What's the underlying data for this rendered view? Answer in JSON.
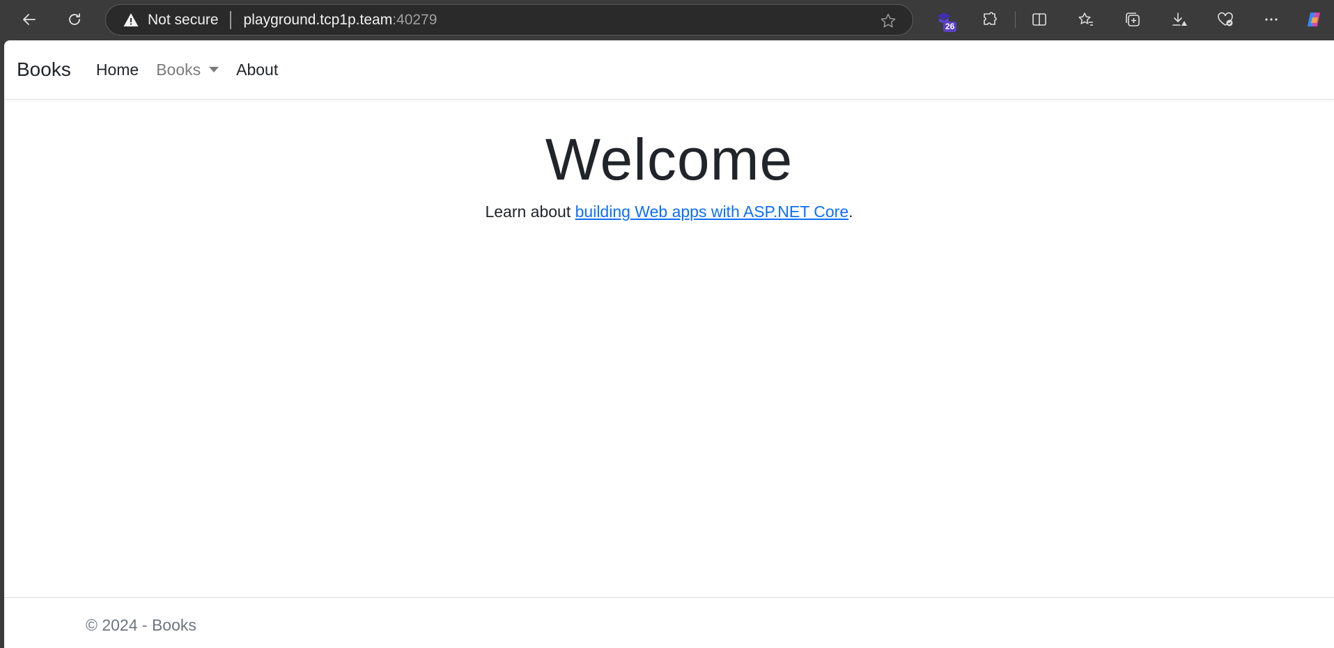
{
  "browser": {
    "security_label": "Not secure",
    "url_host": "playground.tcp1p.team",
    "url_port": ":40279",
    "extension_badge": "26",
    "icons": [
      "back-icon",
      "refresh-icon",
      "warning-icon",
      "star-icon",
      "extension-badge-icon",
      "puzzle-icon",
      "split-screen-icon",
      "favorites-icon",
      "collections-icon",
      "downloads-icon",
      "health-icon",
      "more-icon",
      "copilot-icon"
    ]
  },
  "navbar": {
    "brand": "Books",
    "items": [
      {
        "label": "Home"
      },
      {
        "label": "Books"
      },
      {
        "label": "About"
      }
    ]
  },
  "main": {
    "heading": "Welcome",
    "learn_prefix": "Learn about ",
    "learn_link": "building Web apps with ASP.NET Core",
    "learn_suffix": "."
  },
  "footer": {
    "text": "© 2024 - Books"
  },
  "colors": {
    "chrome_bg": "#3b3b3b",
    "link": "#0d6efd",
    "muted": "#6c757d"
  }
}
